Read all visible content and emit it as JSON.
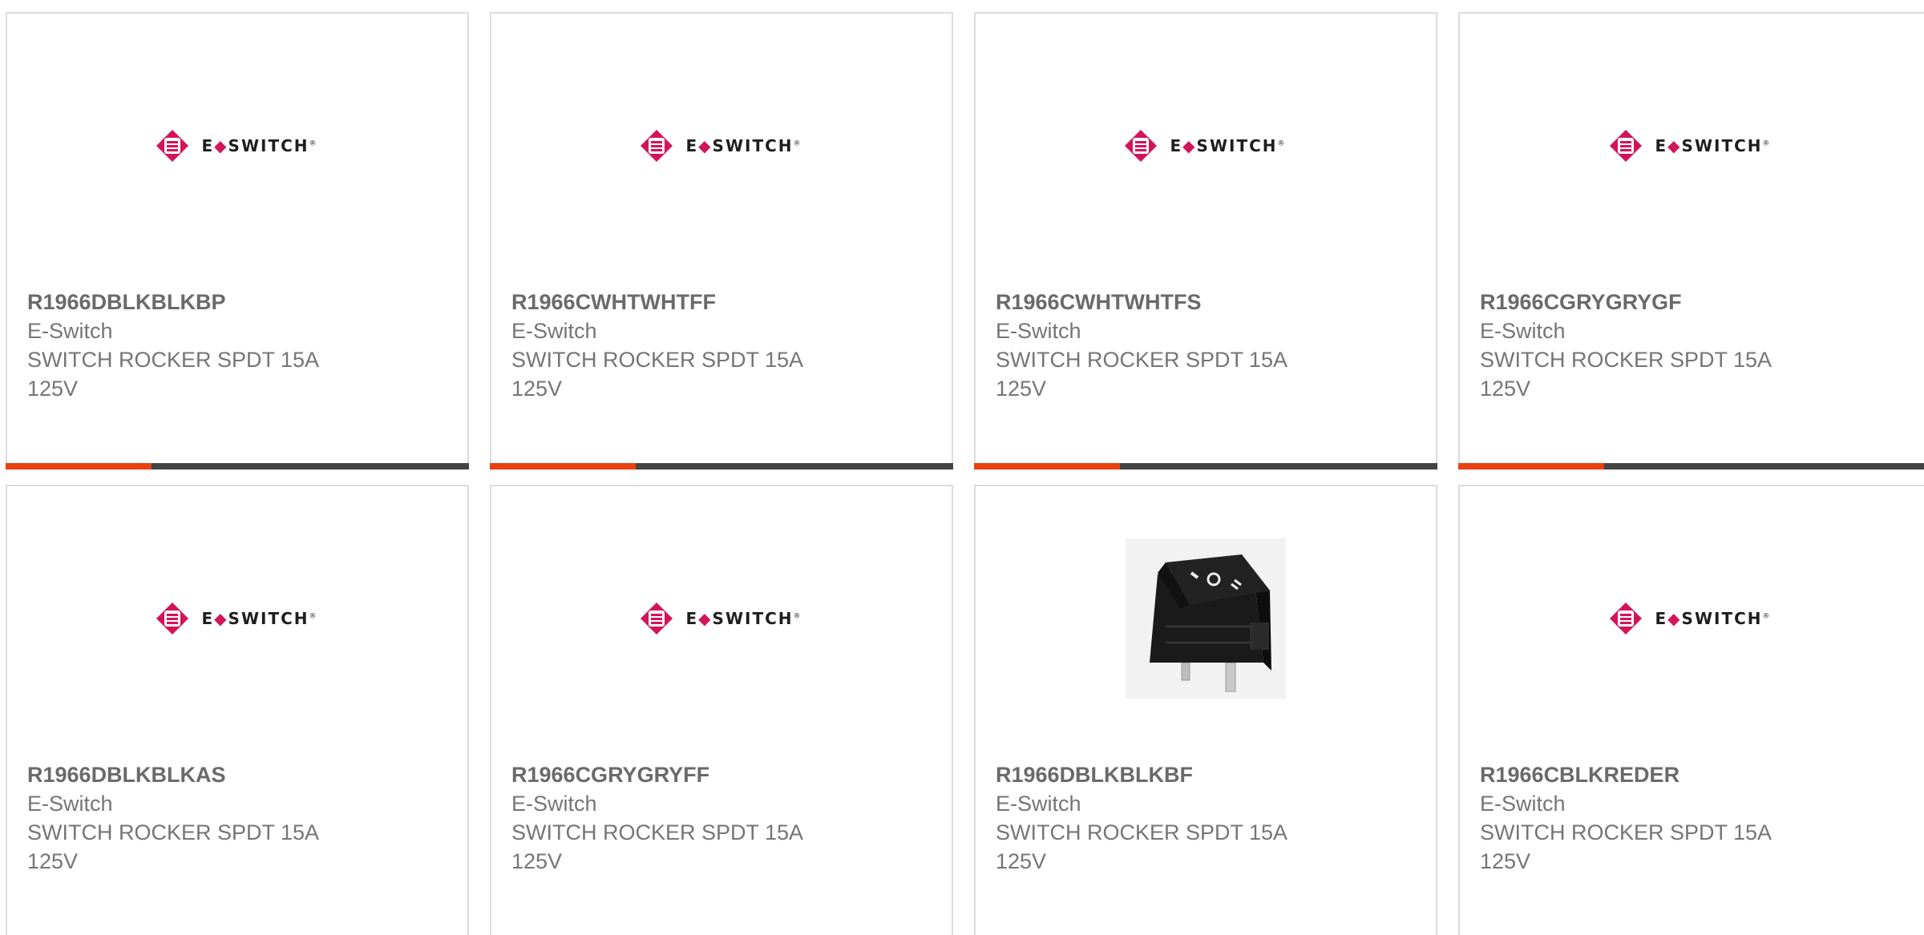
{
  "products": [
    {
      "part_number": "R1966DBLKBLKBP",
      "manufacturer": "E-Switch",
      "description": "SWITCH ROCKER SPDT 15A 125V",
      "image": "eswitch-logo"
    },
    {
      "part_number": "R1966CWHTWHTFF",
      "manufacturer": "E-Switch",
      "description": "SWITCH ROCKER SPDT 15A 125V",
      "image": "eswitch-logo"
    },
    {
      "part_number": "R1966CWHTWHTFS",
      "manufacturer": "E-Switch",
      "description": "SWITCH ROCKER SPDT 15A 125V",
      "image": "eswitch-logo"
    },
    {
      "part_number": "R1966CGRYGRYGF",
      "manufacturer": "E-Switch",
      "description": "SWITCH ROCKER SPDT 15A 125V",
      "image": "eswitch-logo"
    },
    {
      "part_number": "R1966DBLKBLKAS",
      "manufacturer": "E-Switch",
      "description": "SWITCH ROCKER SPDT 15A 125V",
      "image": "eswitch-logo"
    },
    {
      "part_number": "R1966CGRYGRYFF",
      "manufacturer": "E-Switch",
      "description": "SWITCH ROCKER SPDT 15A 125V",
      "image": "eswitch-logo"
    },
    {
      "part_number": "R1966DBLKBLKBF",
      "manufacturer": "E-Switch",
      "description": "SWITCH ROCKER SPDT 15A 125V",
      "image": "rocker-switch-photo"
    },
    {
      "part_number": "R1966CBLKREDER",
      "manufacturer": "E-Switch",
      "description": "SWITCH ROCKER SPDT 15A 125V",
      "image": "eswitch-logo"
    }
  ],
  "logo": {
    "left": "E",
    "right": "SWITCH",
    "mark": "®"
  },
  "colors": {
    "accent": "#e8410f",
    "bar": "#444444",
    "brand": "#d4145a",
    "text_primary": "#6a6a6a",
    "text_secondary": "#757575",
    "border": "#dcdcdc"
  }
}
